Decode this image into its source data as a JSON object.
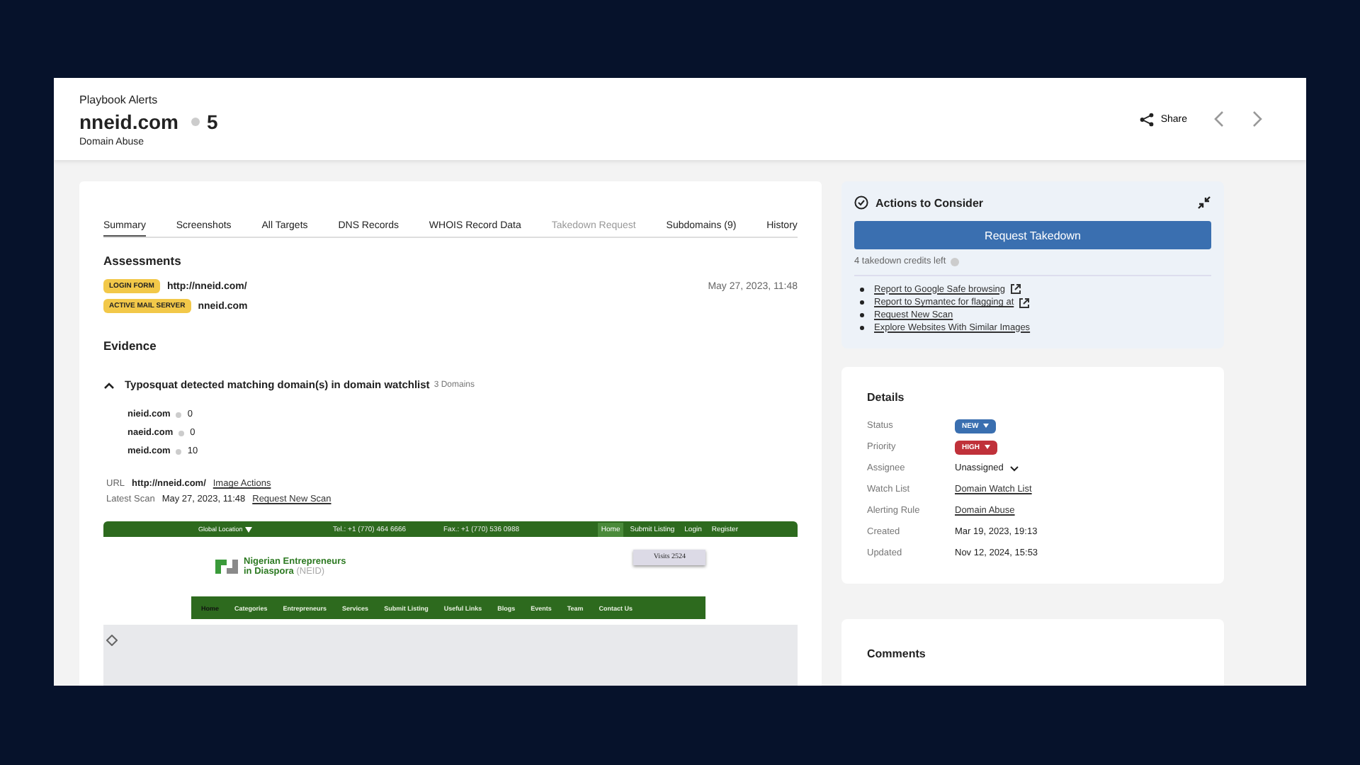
{
  "header": {
    "breadcrumb": "Playbook Alerts",
    "title": "nneid.com",
    "score": "5",
    "subtitle": "Domain Abuse",
    "share": "Share"
  },
  "tabs": [
    {
      "label": "Summary",
      "selected": true,
      "disabled": false
    },
    {
      "label": "Screenshots",
      "selected": false,
      "disabled": false
    },
    {
      "label": "All Targets",
      "selected": false,
      "disabled": false
    },
    {
      "label": "DNS Records",
      "selected": false,
      "disabled": false
    },
    {
      "label": "WHOIS Record Data",
      "selected": false,
      "disabled": false
    },
    {
      "label": "Takedown Request",
      "selected": false,
      "disabled": true
    },
    {
      "label": "Subdomains (9)",
      "selected": false,
      "disabled": false
    },
    {
      "label": "History",
      "selected": false,
      "disabled": false
    }
  ],
  "assessments": {
    "title": "Assessments",
    "items": [
      {
        "tag": "LOGIN FORM",
        "value": "http://nneid.com/",
        "time": "May 27, 2023, 11:48"
      },
      {
        "tag": "ACTIVE MAIL SERVER",
        "value": "nneid.com"
      }
    ]
  },
  "evidence": {
    "title": "Evidence",
    "expanded": true,
    "heading": "Typosquat detected matching domain(s) in domain watchlist",
    "count": "3 Domains",
    "domains": [
      {
        "name": "nieid.com",
        "score": "0"
      },
      {
        "name": "naeid.com",
        "score": "0"
      },
      {
        "name": "meid.com",
        "score": "10"
      }
    ],
    "url_label": "URL",
    "url": "http://nneid.com/",
    "image_actions": "Image Actions",
    "scan_label": "Latest Scan",
    "scan_time": "May 27, 2023, 11:48",
    "scan_link": "Request New Scan"
  },
  "website": {
    "location": "Global Location",
    "tel": "Tel.: +1 (770) 464 6666",
    "fax": "Fax.: +1 (770) 536 0988",
    "top_links": [
      {
        "label": "Home",
        "selected": true
      },
      {
        "label": "Submit Listing",
        "selected": false
      },
      {
        "label": "Login",
        "selected": false
      },
      {
        "label": "Register",
        "selected": false
      }
    ],
    "logo_line1": "Nigerian Entrepreneurs",
    "logo_line2": "in Diaspora",
    "logo_abbr": "(NEID)",
    "visits": "Visits 2524",
    "nav": [
      {
        "label": "Home",
        "selected": true
      },
      {
        "label": "Categories",
        "selected": false
      },
      {
        "label": "Entrepreneurs",
        "selected": false
      },
      {
        "label": "Services",
        "selected": false
      },
      {
        "label": "Submit Listing",
        "selected": false
      },
      {
        "label": "Useful Links",
        "selected": false
      },
      {
        "label": "Blogs",
        "selected": false
      },
      {
        "label": "Events",
        "selected": false
      },
      {
        "label": "Team",
        "selected": false
      },
      {
        "label": "Contact Us",
        "selected": false
      }
    ]
  },
  "actions": {
    "title": "Actions to Consider",
    "button": "Request Takedown",
    "credits": "4 takedown credits left",
    "links": [
      {
        "label": "Report to Google Safe browsing",
        "external": true
      },
      {
        "label": "Report to Symantec for flagging at",
        "external": true
      },
      {
        "label": "Request New Scan",
        "external": false
      },
      {
        "label": "Explore Websites With Similar Images",
        "external": false
      }
    ]
  },
  "details": {
    "title": "Details",
    "rows": [
      {
        "label": "Status",
        "kind": "badge",
        "value": "NEW",
        "color": "#3a6fb0"
      },
      {
        "label": "Priority",
        "kind": "badge",
        "value": "HIGH",
        "color": "#c0313a"
      },
      {
        "label": "Assignee",
        "kind": "select",
        "value": "Unassigned"
      },
      {
        "label": "Watch List",
        "kind": "link",
        "value": "Domain Watch List"
      },
      {
        "label": "Alerting Rule",
        "kind": "link",
        "value": "Domain Abuse"
      },
      {
        "label": "Created",
        "kind": "text",
        "value": "Mar 19, 2023, 19:13"
      },
      {
        "label": "Updated",
        "kind": "text",
        "value": "Nov 12, 2024, 15:53"
      }
    ]
  },
  "comments": {
    "title": "Comments"
  }
}
